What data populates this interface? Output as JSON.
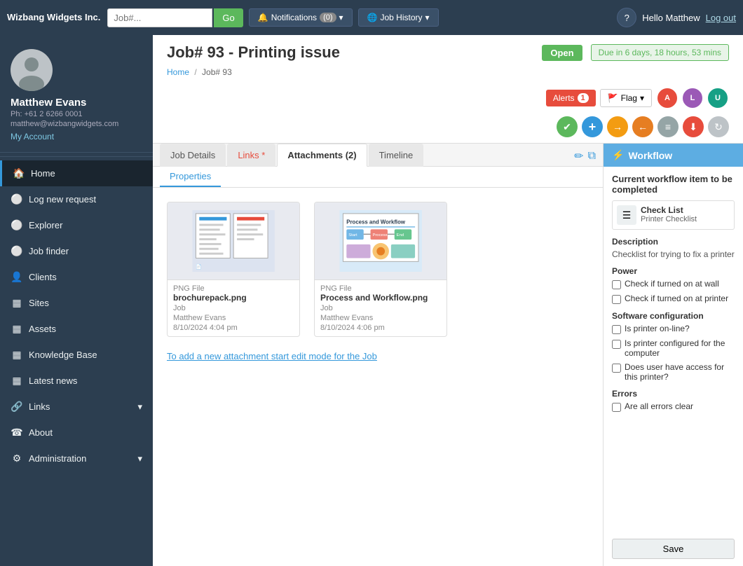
{
  "brand": {
    "name": "Wizbang Widgets Inc."
  },
  "topnav": {
    "search_placeholder": "Job#...",
    "go_label": "Go",
    "notifications_label": "Notifications",
    "notifications_count": "(0)",
    "job_history_label": "Job History",
    "help_label": "?",
    "hello_label": "Hello Matthew",
    "logout_label": "Log out"
  },
  "sidebar": {
    "user": {
      "name": "Matthew Evans",
      "phone": "Ph: +61 2 6266 0001",
      "email": "matthew@wizbangwidgets.com",
      "my_account_label": "My Account"
    },
    "nav_items": [
      {
        "id": "home",
        "label": "Home",
        "icon": "🏠",
        "active": true
      },
      {
        "id": "log-new-request",
        "label": "Log new request",
        "icon": "⚪"
      },
      {
        "id": "explorer",
        "label": "Explorer",
        "icon": "⚪"
      },
      {
        "id": "job-finder",
        "label": "Job finder",
        "icon": "⚪"
      },
      {
        "id": "clients",
        "label": "Clients",
        "icon": "👤"
      },
      {
        "id": "sites",
        "label": "Sites",
        "icon": "▦"
      },
      {
        "id": "assets",
        "label": "Assets",
        "icon": "▦"
      },
      {
        "id": "knowledge-base",
        "label": "Knowledge Base",
        "icon": "▦"
      },
      {
        "id": "latest-news",
        "label": "Latest news",
        "icon": "▦"
      },
      {
        "id": "links",
        "label": "Links",
        "icon": "🔗",
        "has_arrow": true
      },
      {
        "id": "about",
        "label": "About",
        "icon": "☎"
      },
      {
        "id": "administration",
        "label": "Administration",
        "icon": "⚙",
        "has_arrow": true
      }
    ]
  },
  "job": {
    "number": "Job# 93",
    "title": "Job# 93 - Printing issue",
    "status": "Open",
    "due": "Due in 6 days, 18 hours, 53 mins",
    "breadcrumb_home": "Home",
    "breadcrumb_job": "Job# 93",
    "alerts_label": "Alerts",
    "alerts_count": "1",
    "flag_label": "Flag",
    "avatars": [
      {
        "initials": "A",
        "color": "#e74c3c"
      },
      {
        "initials": "L",
        "color": "#8e44ad"
      },
      {
        "initials": "U",
        "color": "#16a085"
      }
    ],
    "action_icons": [
      {
        "id": "check",
        "symbol": "✔",
        "color": "#5cb85c"
      },
      {
        "id": "plus",
        "symbol": "+",
        "color": "#3498db"
      },
      {
        "id": "arrow-right",
        "symbol": "→",
        "color": "#f39c12"
      },
      {
        "id": "arrow-left",
        "symbol": "←",
        "color": "#e67e22"
      },
      {
        "id": "equals",
        "symbol": "≡",
        "color": "#95a5a6"
      },
      {
        "id": "down-circle",
        "symbol": "⬇",
        "color": "#e74c3c"
      },
      {
        "id": "sync",
        "symbol": "↻",
        "color": "#bdc3c7"
      }
    ]
  },
  "tabs": {
    "items": [
      {
        "id": "job-details",
        "label": "Job Details",
        "active": false,
        "modified": false
      },
      {
        "id": "links",
        "label": "Links *",
        "active": false,
        "modified": true
      },
      {
        "id": "attachments",
        "label": "Attachments (2)",
        "active": true,
        "modified": false
      },
      {
        "id": "timeline",
        "label": "Timeline",
        "active": false,
        "modified": false
      }
    ],
    "sub_tabs": [
      {
        "id": "properties",
        "label": "Properties",
        "active": true
      }
    ]
  },
  "attachments": {
    "items": [
      {
        "id": "att1",
        "type": "PNG File",
        "name": "brochurepack.png",
        "owner": "Job",
        "uploaded_by": "Matthew Evans",
        "date": "8/10/2024 4:04 pm"
      },
      {
        "id": "att2",
        "type": "PNG File",
        "name": "Process and Workflow.png",
        "owner": "Job",
        "uploaded_by": "Matthew Evans",
        "date": "8/10/2024 4:06 pm"
      }
    ],
    "add_link_text": "To add a new attachment start edit mode for the Job"
  },
  "workflow": {
    "header_label": "Workflow",
    "current_item_title": "Current workflow item to be completed",
    "item": {
      "name": "Check List",
      "sub": "Printer Checklist"
    },
    "description_label": "Description",
    "description_text": "Checklist for trying to fix a printer",
    "sections": [
      {
        "title": "Power",
        "checks": [
          {
            "id": "c1",
            "label": "Check if turned on at wall"
          },
          {
            "id": "c2",
            "label": "Check if turned on at printer"
          }
        ]
      },
      {
        "title": "Software configuration",
        "checks": [
          {
            "id": "c3",
            "label": "Is printer on-line?"
          },
          {
            "id": "c4",
            "label": "Is printer configured for the computer"
          },
          {
            "id": "c5",
            "label": "Does user have access for this printer?"
          }
        ]
      },
      {
        "title": "Errors",
        "checks": [
          {
            "id": "c6",
            "label": "Are all errors clear"
          }
        ]
      }
    ],
    "save_label": "Save"
  }
}
